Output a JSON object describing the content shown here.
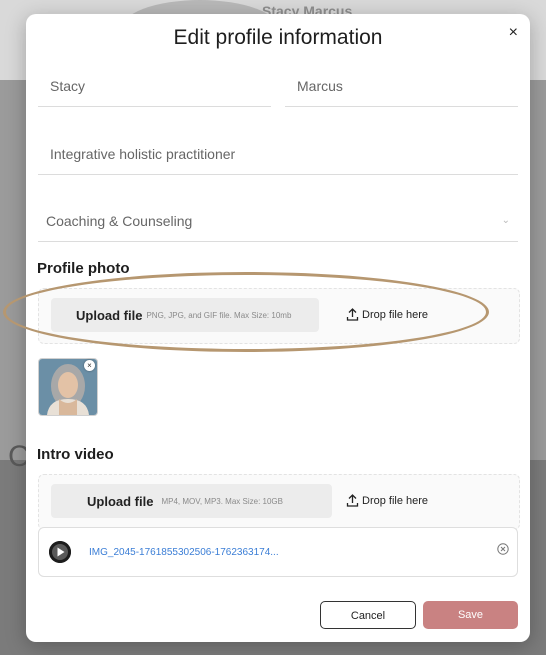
{
  "modal": {
    "title": "Edit profile information",
    "close_glyph": "×"
  },
  "form": {
    "first_name": "Stacy",
    "last_name": "Marcus",
    "headline": "Integrative holistic practitioner",
    "category": "Coaching & Counseling",
    "category_chevron": "⌄"
  },
  "profile_photo": {
    "heading": "Profile photo",
    "upload_label": "Upload file",
    "upload_hint": "PNG, JPG, and GIF file. Max Size: 10mb",
    "drop_label": "Drop file here",
    "remove_glyph": "×"
  },
  "intro_video": {
    "heading": "Intro video",
    "upload_label": "Upload file",
    "upload_hint": "MP4, MOV, MP3. Max Size: 10GB",
    "drop_label": "Drop file here",
    "file_name": "IMG_2045-1761855302506-1762363174..."
  },
  "actions": {
    "cancel_label": "Cancel",
    "save_label": "Save"
  },
  "background": {
    "name_text": "Stacy Marcus",
    "letter": "C"
  },
  "colors": {
    "save_button": "#c98282",
    "highlight_ring": "#b69770",
    "link": "#3b7ed6"
  },
  "icons": {
    "close": "close-icon",
    "chevron": "chevron-down-icon",
    "upload": "upload-icon",
    "play": "play-icon",
    "remove": "remove-circle-icon"
  }
}
